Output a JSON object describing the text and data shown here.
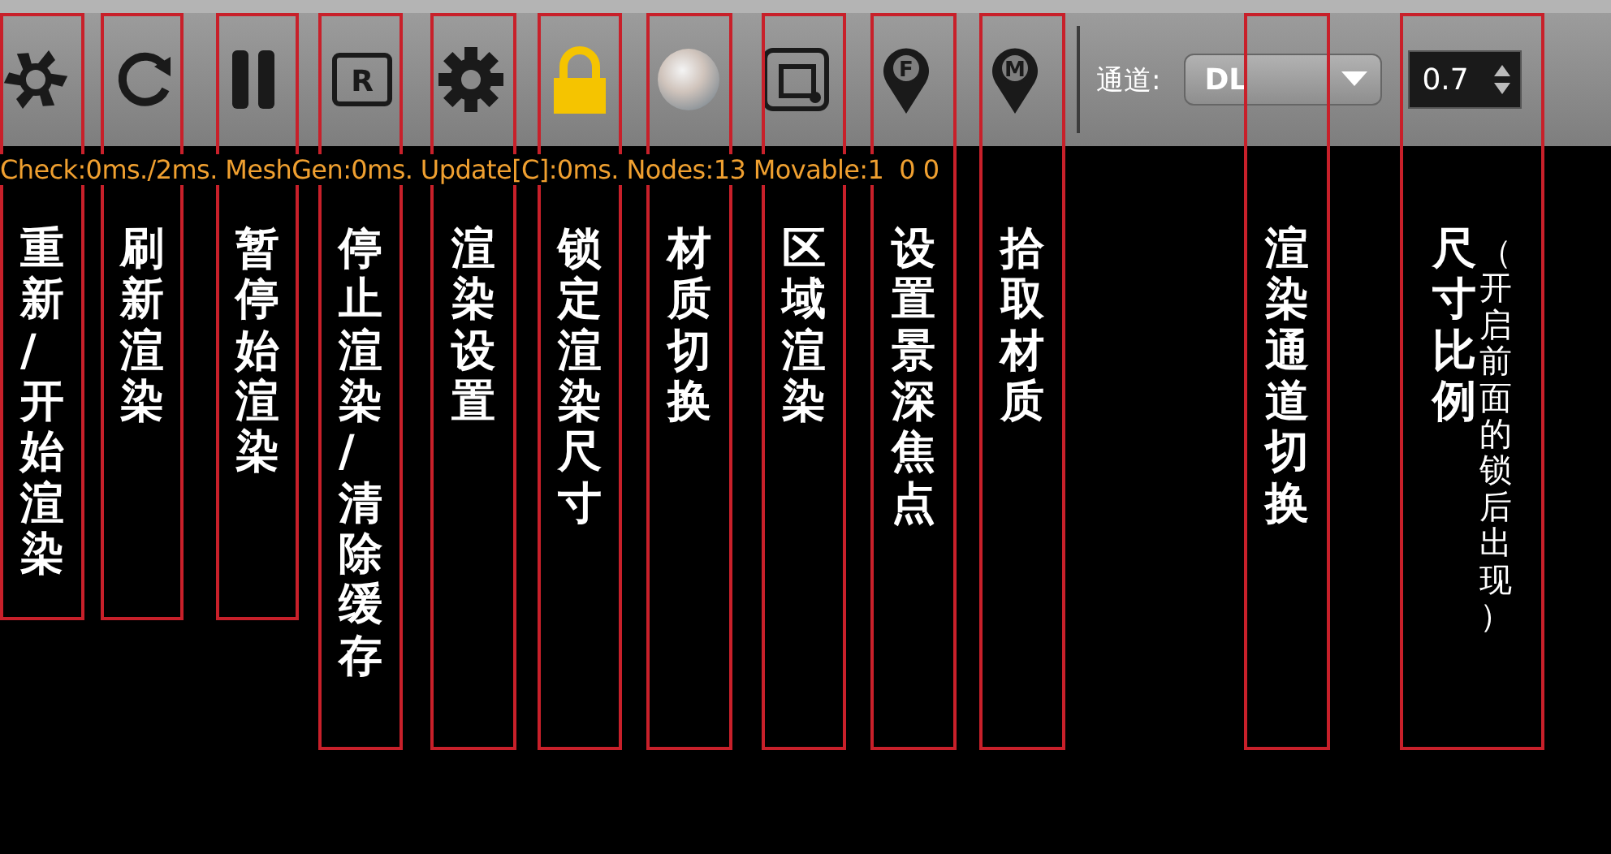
{
  "toolbar": {
    "buttons": [
      {
        "kind": "aperture"
      },
      {
        "kind": "refresh"
      },
      {
        "kind": "pause"
      },
      {
        "kind": "region-letter",
        "glyph": "R"
      },
      {
        "kind": "gear"
      },
      {
        "kind": "lock"
      },
      {
        "kind": "sphere"
      },
      {
        "kind": "region"
      },
      {
        "kind": "pin",
        "glyph": "F"
      },
      {
        "kind": "pin",
        "glyph": "M"
      }
    ],
    "channel": {
      "label": "通道:",
      "value": "DL"
    },
    "scale": {
      "value": "0.7"
    }
  },
  "status_line": "Check:0ms./2ms. MeshGen:0ms. Update[C]:0ms. Nodes:13 Movable:1  0 0",
  "annotations": [
    {
      "label": "重新/开始渲染"
    },
    {
      "label": "刷新渲染"
    },
    {
      "label": "暂停始渲染"
    },
    {
      "label": "停止渲染/清除缓存"
    },
    {
      "label": "渲染设置"
    },
    {
      "label": "锁定渲染尺寸"
    },
    {
      "label": "材质切换"
    },
    {
      "label": "区域渲染"
    },
    {
      "label": "设置景深焦点"
    },
    {
      "label": "拾取材质"
    },
    {
      "label": "渲染通道切换"
    },
    {
      "label": "尺寸比例",
      "note": "（开启前面的锁后出现）"
    }
  ]
}
